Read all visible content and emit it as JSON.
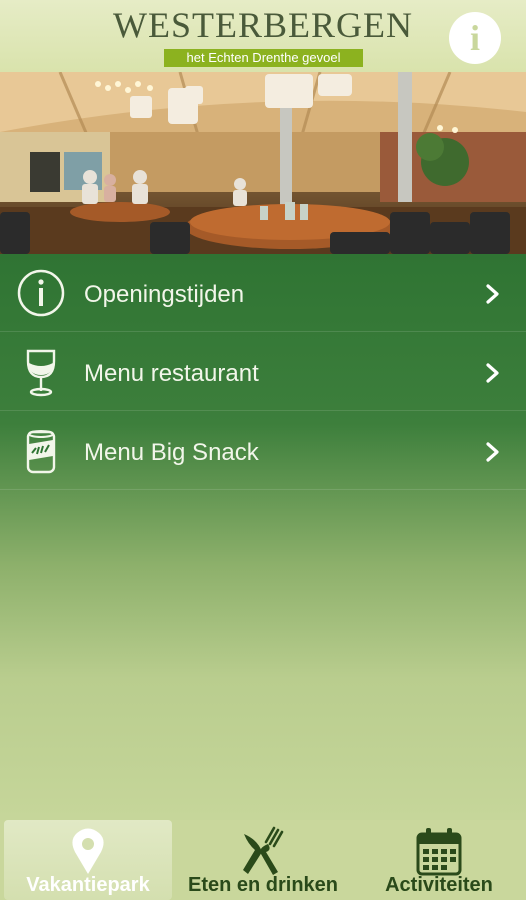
{
  "header": {
    "title": "WESTERBERGEN",
    "tagline": "het Echten Drenthe gevoel",
    "info_icon": "info-icon"
  },
  "hero": {
    "icon": "restaurant-photo"
  },
  "menu": {
    "items": [
      {
        "label": "Openingstijden",
        "icon": "info-circle-icon"
      },
      {
        "label": "Menu restaurant",
        "icon": "wine-glass-icon"
      },
      {
        "label": "Menu Big Snack",
        "icon": "drink-can-icon"
      }
    ]
  },
  "tabbar": {
    "tabs": [
      {
        "label": "Vakantiepark",
        "icon": "location-pin-icon",
        "active": true
      },
      {
        "label": "Eten en drinken",
        "icon": "fork-knife-icon",
        "active": false
      },
      {
        "label": "Activiteiten",
        "icon": "calendar-icon",
        "active": false
      }
    ]
  },
  "colors": {
    "brand_green": "#2f7433",
    "tagline_green": "#8cb21f",
    "background": "#c9d79c"
  }
}
